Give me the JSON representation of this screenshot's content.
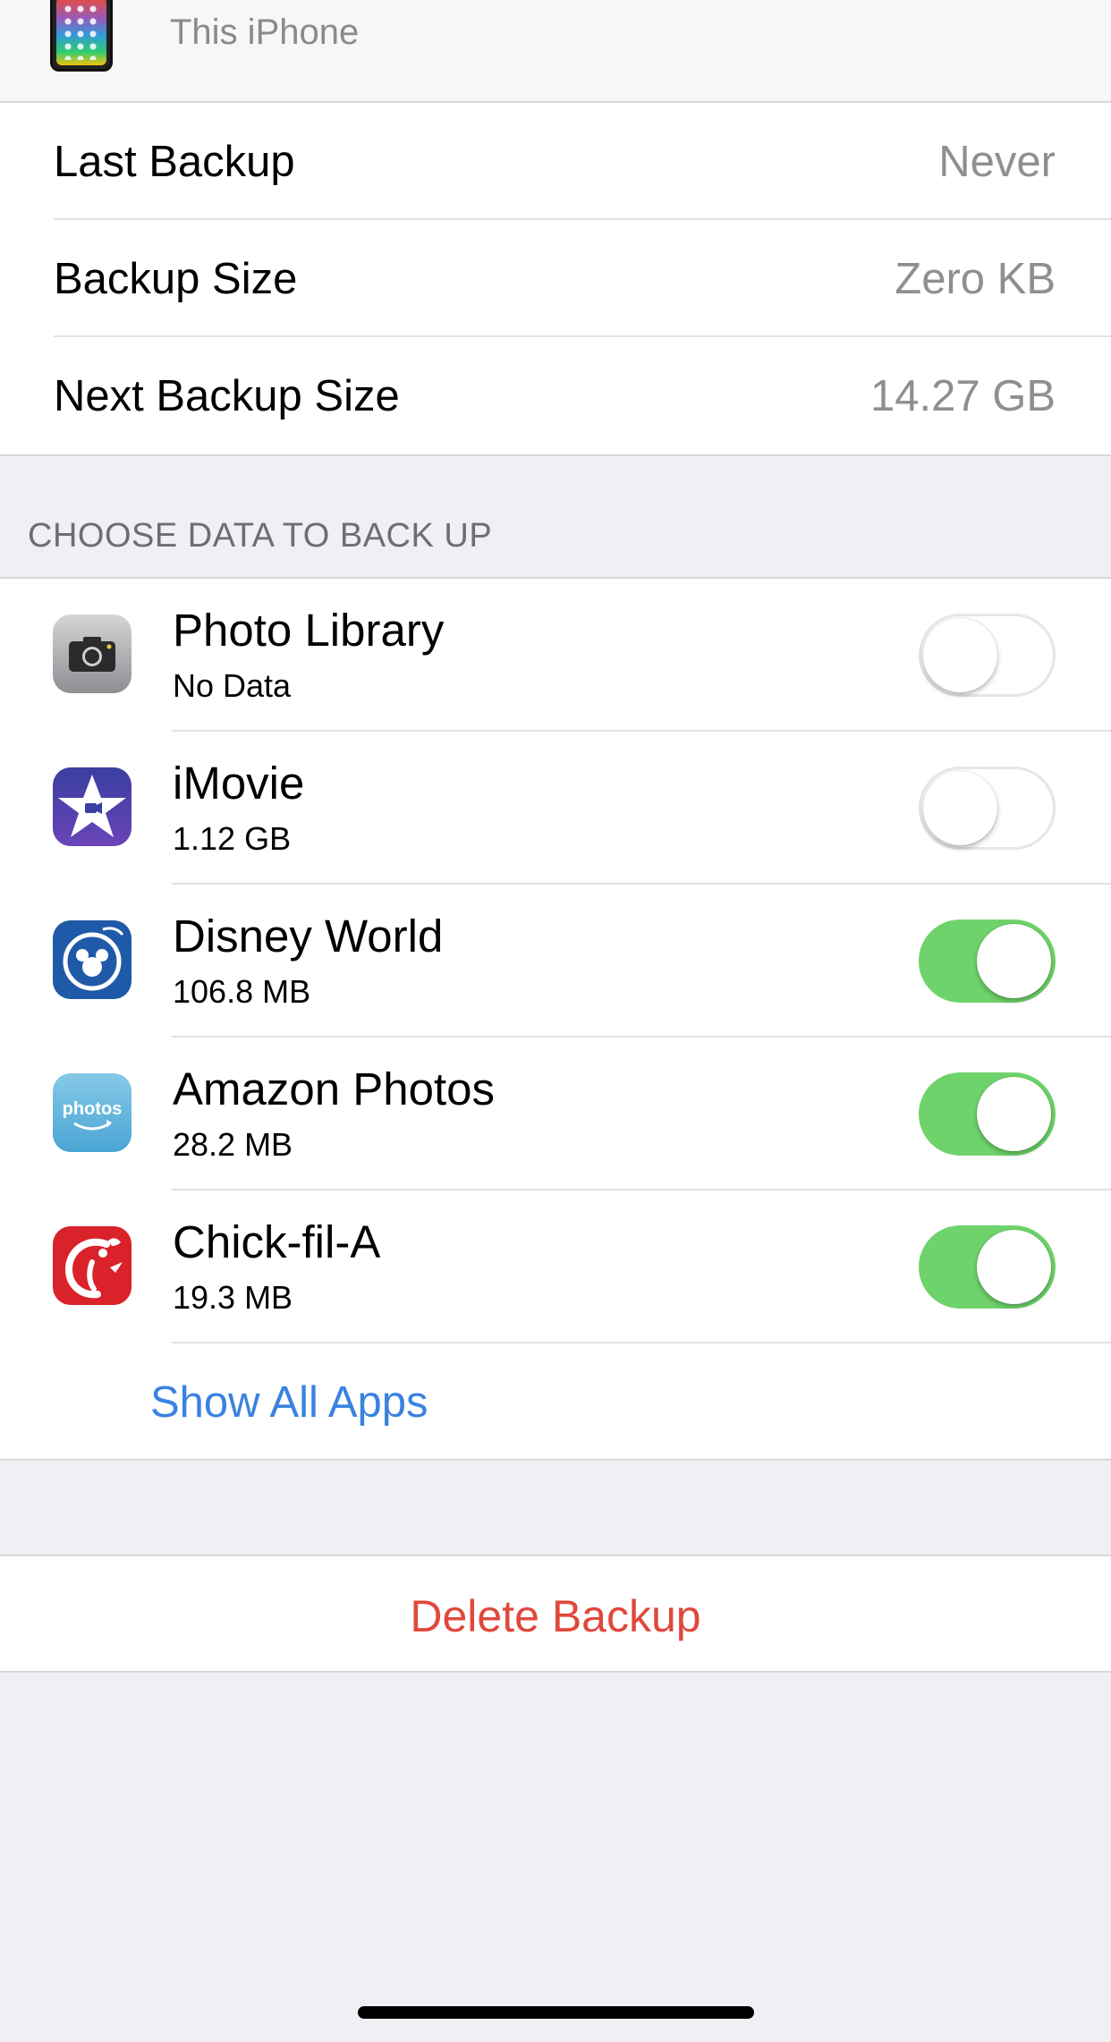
{
  "device": {
    "subtitle": "This iPhone"
  },
  "info": [
    {
      "label": "Last Backup",
      "value": "Never"
    },
    {
      "label": "Backup Size",
      "value": "Zero KB"
    },
    {
      "label": "Next Backup Size",
      "value": "14.27 GB"
    }
  ],
  "section_header": "CHOOSE DATA TO BACK UP",
  "apps": [
    {
      "name": "Photo Library",
      "size": "No Data",
      "icon": "camera-icon",
      "enabled": false
    },
    {
      "name": "iMovie",
      "size": "1.12 GB",
      "icon": "imovie-star-icon",
      "enabled": false
    },
    {
      "name": "Disney World",
      "size": "106.8 MB",
      "icon": "mickey-icon",
      "enabled": true
    },
    {
      "name": "Amazon Photos",
      "size": "28.2 MB",
      "icon": "photos-icon",
      "enabled": true
    },
    {
      "name": "Chick-fil-A",
      "size": "19.3 MB",
      "icon": "chickfila-icon",
      "enabled": true
    }
  ],
  "apps_icon_text": {
    "amazon": "photos"
  },
  "show_all_label": "Show All Apps",
  "delete_label": "Delete Backup",
  "colors": {
    "toggle_on": "#6fd36b",
    "link_blue": "#3a82e0",
    "destructive_red": "#e0483b",
    "background": "#efeff4"
  }
}
